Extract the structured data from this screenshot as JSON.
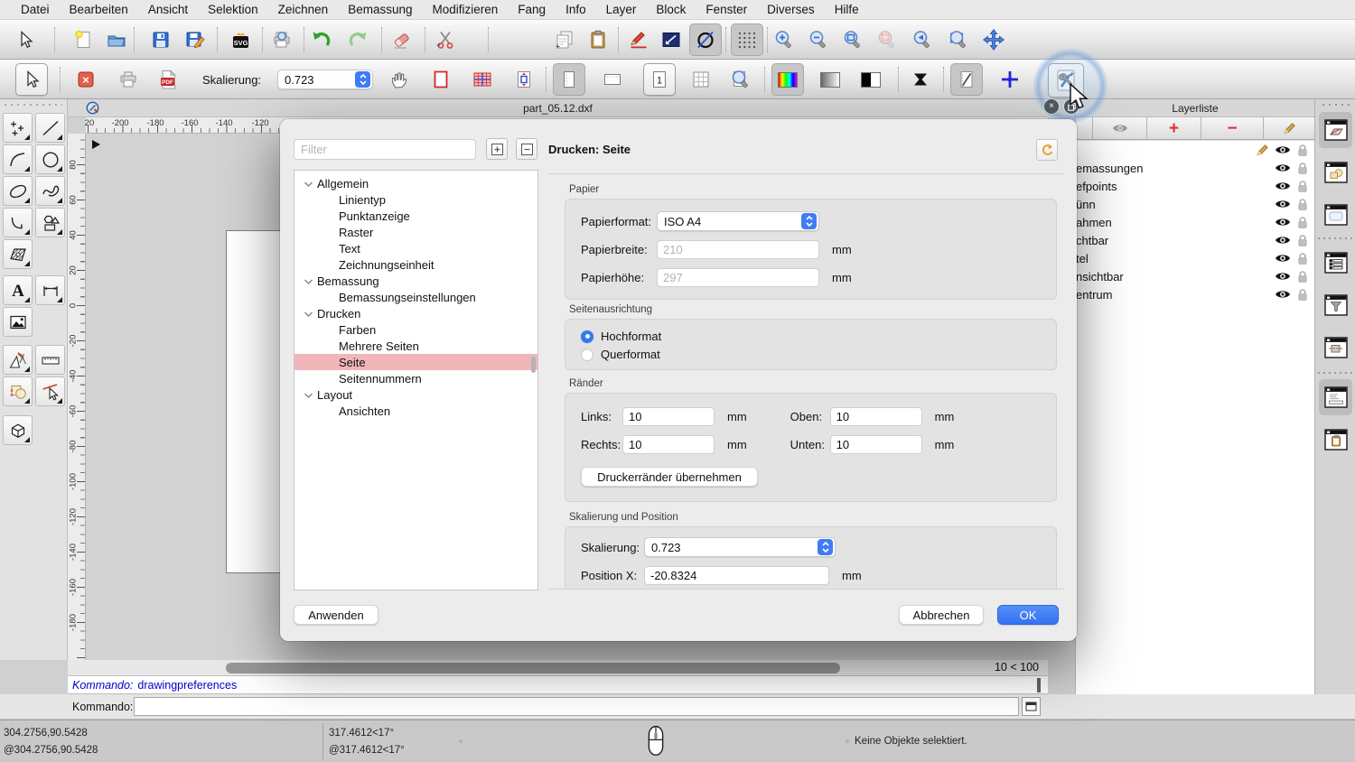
{
  "menubar": {
    "items": [
      "Datei",
      "Bearbeiten",
      "Ansicht",
      "Selektion",
      "Zeichnen",
      "Bemassung",
      "Modifizieren",
      "Fang",
      "Info",
      "Layer",
      "Block",
      "Fenster",
      "Diverses",
      "Hilfe"
    ]
  },
  "toolbar": {
    "scale_label": "Skalierung:",
    "scale_value": "0.723",
    "page_number": "1"
  },
  "icon_text": {
    "svg_badge": "SVG",
    "pdf_badge": "PDF",
    "text_tool": "A",
    "add": "+",
    "remove": "−",
    "close": "×"
  },
  "document": {
    "title": "part_05.12.dxf",
    "h_ruler_labels": [
      "20",
      "-200",
      "-180",
      "-160",
      "-140",
      "-120"
    ],
    "v_ruler_labels": [
      "80",
      "60",
      "40",
      "20",
      "0",
      "-20",
      "-40",
      "-60",
      "-80",
      "-100",
      "-120",
      "-140",
      "-160",
      "-180"
    ],
    "zoom_indicator": "10 < 100"
  },
  "dialog": {
    "title": "Drucken: Seite",
    "filter_placeholder": "Filter",
    "tree": [
      {
        "label": "Allgemein"
      },
      {
        "label": "Linientyp"
      },
      {
        "label": "Punktanzeige"
      },
      {
        "label": "Raster"
      },
      {
        "label": "Text"
      },
      {
        "label": "Zeichnungseinheit"
      },
      {
        "label": "Bemassung"
      },
      {
        "label": "Bemassungseinstellungen"
      },
      {
        "label": "Drucken"
      },
      {
        "label": "Farben"
      },
      {
        "label": "Mehrere Seiten"
      },
      {
        "label": "Seite"
      },
      {
        "label": "Seitennummern"
      },
      {
        "label": "Layout"
      },
      {
        "label": "Ansichten"
      }
    ],
    "papier": {
      "section": "Papier",
      "format_label": "Papierformat:",
      "format_value": "ISO A4",
      "breite_label": "Papierbreite:",
      "breite_value": "210",
      "hoehe_label": "Papierhöhe:",
      "hoehe_value": "297",
      "unit": "mm"
    },
    "ausrichtung": {
      "section": "Seitenausrichtung",
      "hochformat": "Hochformat",
      "querformat": "Querformat"
    },
    "raender": {
      "section": "Ränder",
      "links_label": "Links:",
      "links_value": "10",
      "oben_label": "Oben:",
      "oben_value": "10",
      "rechts_label": "Rechts:",
      "rechts_value": "10",
      "unten_label": "Unten:",
      "unten_value": "10",
      "unit": "mm",
      "printer_margins_button": "Druckerränder übernehmen"
    },
    "skalierung": {
      "section": "Skalierung und Position",
      "scale_label": "Skalierung:",
      "scale_value": "0.723",
      "pos_x_label": "Position X:",
      "pos_x_value": "-20.8324",
      "unit": "mm"
    },
    "buttons": {
      "apply": "Anwenden",
      "cancel": "Abbrechen",
      "ok": "OK"
    }
  },
  "layer_panel": {
    "title": "Layerliste",
    "layers": [
      "emassungen",
      "efpoints",
      "ünn",
      "ahmen",
      "chtbar",
      "tel",
      "nsichtbar",
      "entrum"
    ]
  },
  "command": {
    "history_label": "Kommando:",
    "history_value": "drawingpreferences",
    "prompt_label": "Kommando:"
  },
  "statusbar": {
    "abs_coord": "304.2756,90.5428",
    "rel_coord": "@304.2756,90.5428",
    "abs_polar": "317.4612<17°",
    "rel_polar": "@317.4612<17°",
    "selection_status": "Keine Objekte selektiert."
  }
}
